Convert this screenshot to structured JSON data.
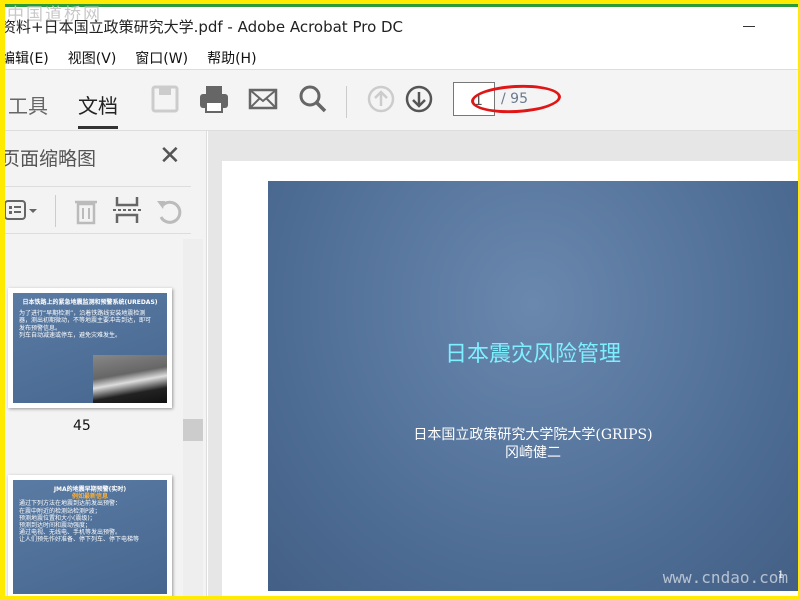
{
  "watermark": "中国道桥网",
  "window": {
    "title": "资料+日本国立政策研究大学.pdf - Adobe Acrobat Pro DC"
  },
  "menu": [
    "编辑(E)",
    "视图(V)",
    "窗口(W)",
    "帮助(H)"
  ],
  "toolbar": {
    "tabs": [
      "工具",
      "文档"
    ],
    "active_tab": "文档",
    "page_input": "1",
    "page_total": "/ 95"
  },
  "panel": {
    "title": "页面缩略图",
    "thumb_label": "45",
    "thumbs": [
      {
        "title": "日本铁路上的紧急地震监测和预警系统(UREDAS)",
        "bullets": [
          "为了进行“早期检测”，沿着铁路线安装地震检测器，测出初期微动，不等地震主要冲击到达，即可发布预警信息。",
          "列车自动减速或停车，避免灾难发生。"
        ]
      },
      {
        "title": "JMA的地震早期预警(实时)",
        "subtitle": "例如最新信息",
        "bullets": [
          "通过下列方法在地震到达前发出预警：",
          "在震中附近的检测站检测P波；",
          "预测地震位置和大小(震级)；",
          "预测到达时间和震动强度；",
          "通过电视、无线电、手机等发出预警。",
          "让人们预先作好准备、停下列车、停下电梯等"
        ]
      }
    ]
  },
  "slide": {
    "title": "日本震灾风险管理",
    "subtitle": "日本国立政策研究大学院大学(GRIPS)",
    "author": "冈崎健二",
    "page_no": "1"
  },
  "watermark2": "www.cndao.com",
  "colors": {
    "accent_red": "#e01515",
    "slide_title": "#7df0ff",
    "slide_bg": "#4c6b93"
  }
}
